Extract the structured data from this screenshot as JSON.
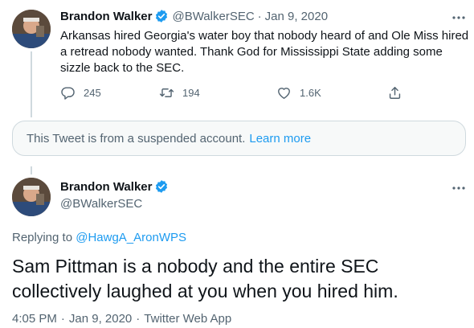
{
  "colors": {
    "accent": "#1d9bf0",
    "text": "#0f1419",
    "muted": "#536471",
    "border": "#cfd9de"
  },
  "first_tweet": {
    "name": "Brandon Walker",
    "handle": "@BWalkerSEC",
    "separator": "·",
    "date": "Jan 9, 2020",
    "text": "Arkansas hired Georgia's water boy that nobody heard of  and Ole Miss hired a retread nobody wanted. Thank God for Mississippi State adding some sizzle back to the SEC.",
    "replies": "245",
    "retweets": "194",
    "likes": "1.6K",
    "icons": [
      "reply-icon",
      "retweet-icon",
      "like-icon",
      "share-icon",
      "more-icon",
      "verified-badge-icon"
    ]
  },
  "notice": {
    "text": "This Tweet is from a suspended account.",
    "link": "Learn more"
  },
  "main_tweet": {
    "name": "Brandon Walker",
    "handle": "@BWalkerSEC",
    "replying_prefix": "Replying to",
    "replying_to": "@HawgA_AronWPS",
    "text": "Sam Pittman is a nobody and the entire SEC collectively laughed at you when you hired him.",
    "time": "4:05 PM",
    "separator": "·",
    "date": "Jan 9, 2020",
    "source": "Twitter Web App"
  }
}
